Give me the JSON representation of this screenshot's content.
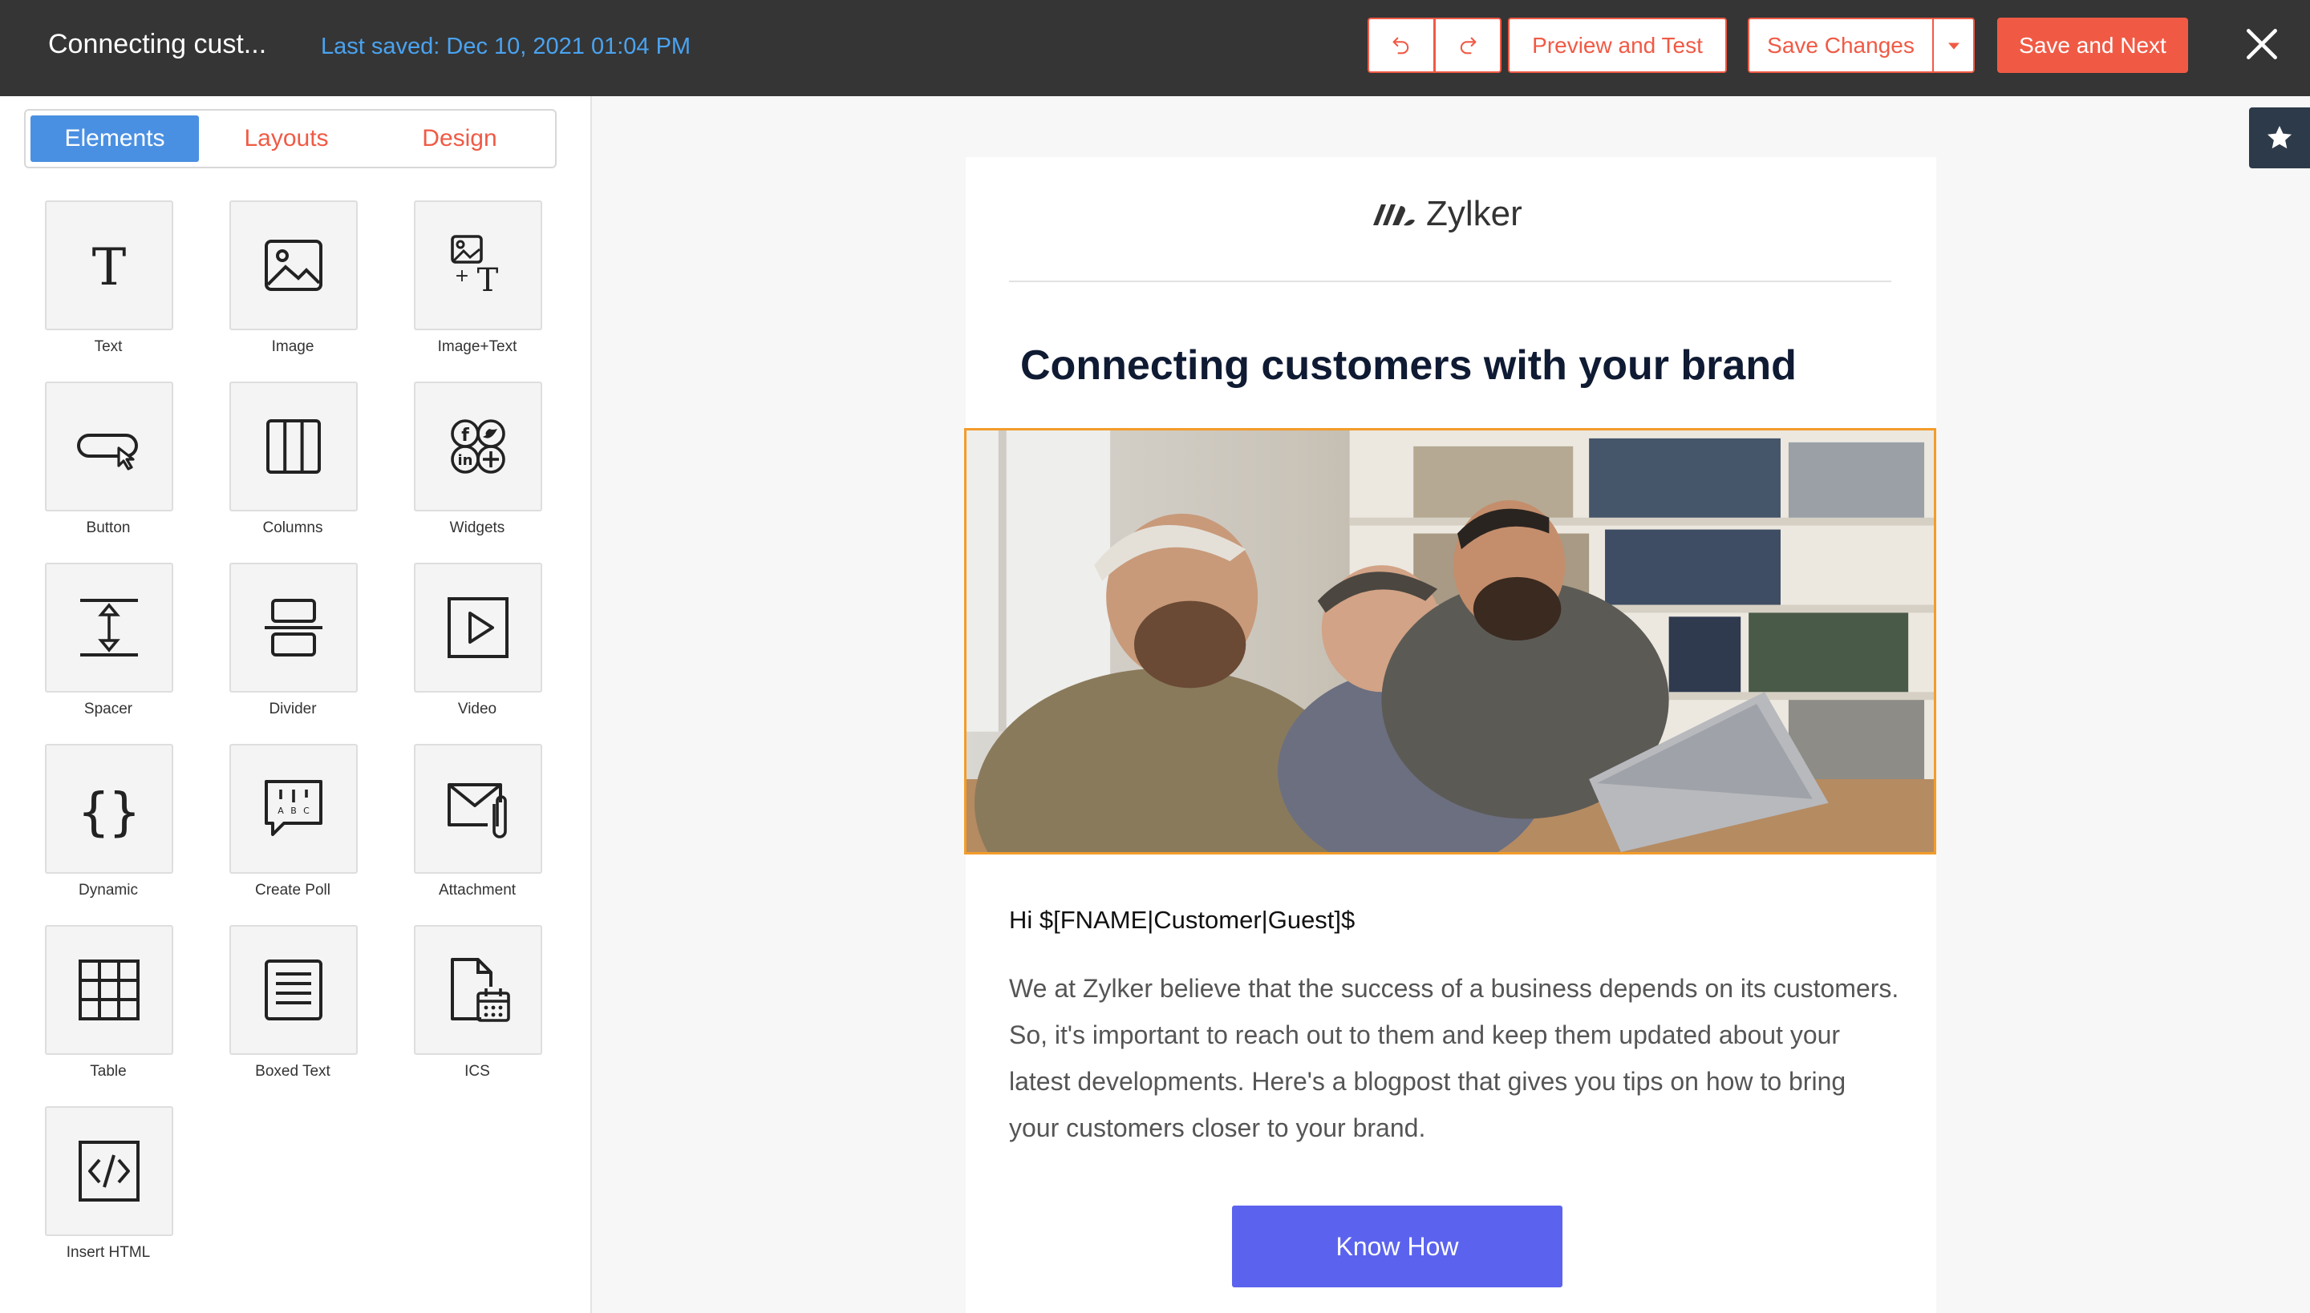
{
  "header": {
    "title": "Connecting cust...",
    "last_saved": "Last saved: Dec 10, 2021 01:04 PM",
    "undo_icon": "undo-icon",
    "redo_icon": "redo-icon",
    "preview_label": "Preview and Test",
    "save_label": "Save Changes",
    "save_next_label": "Save and Next",
    "close_icon": "close-icon"
  },
  "sidebar": {
    "tabs": [
      {
        "label": "Elements",
        "active": true
      },
      {
        "label": "Layouts",
        "active": false
      },
      {
        "label": "Design",
        "active": false
      }
    ],
    "elements": [
      {
        "label": "Text",
        "icon": "text-icon"
      },
      {
        "label": "Image",
        "icon": "image-icon"
      },
      {
        "label": "Image+Text",
        "icon": "image-text-icon"
      },
      {
        "label": "Button",
        "icon": "button-icon"
      },
      {
        "label": "Columns",
        "icon": "columns-icon"
      },
      {
        "label": "Widgets",
        "icon": "social-widgets-icon"
      },
      {
        "label": "Spacer",
        "icon": "spacer-icon"
      },
      {
        "label": "Divider",
        "icon": "divider-icon"
      },
      {
        "label": "Video",
        "icon": "video-icon"
      },
      {
        "label": "Dynamic",
        "icon": "curly-braces-icon"
      },
      {
        "label": "Create Poll",
        "icon": "poll-icon"
      },
      {
        "label": "Attachment",
        "icon": "attachment-icon"
      },
      {
        "label": "Table",
        "icon": "table-icon"
      },
      {
        "label": "Boxed Text",
        "icon": "boxed-text-icon"
      },
      {
        "label": "ICS",
        "icon": "calendar-file-icon"
      },
      {
        "label": "Insert HTML",
        "icon": "code-icon"
      }
    ]
  },
  "email": {
    "brand": "Zylker",
    "headline": "Connecting customers with your brand",
    "greeting": "Hi $[FNAME|Customer|Guest]$",
    "body": "We at Zylker believe that the success of a business depends on its customers. So, it's important to reach out to them and keep them updated about your latest developments. Here's a blogpost that gives you tips on how to bring your customers closer to your brand.",
    "cta_label": "Know How"
  },
  "colors": {
    "topbar": "#353535",
    "accent": "#f05a45",
    "link_blue": "#4aa3f0",
    "tab_active": "#4a90e2",
    "cta": "#5b63ee",
    "selection": "#f39c2a"
  },
  "favorite_icon": "star-icon"
}
